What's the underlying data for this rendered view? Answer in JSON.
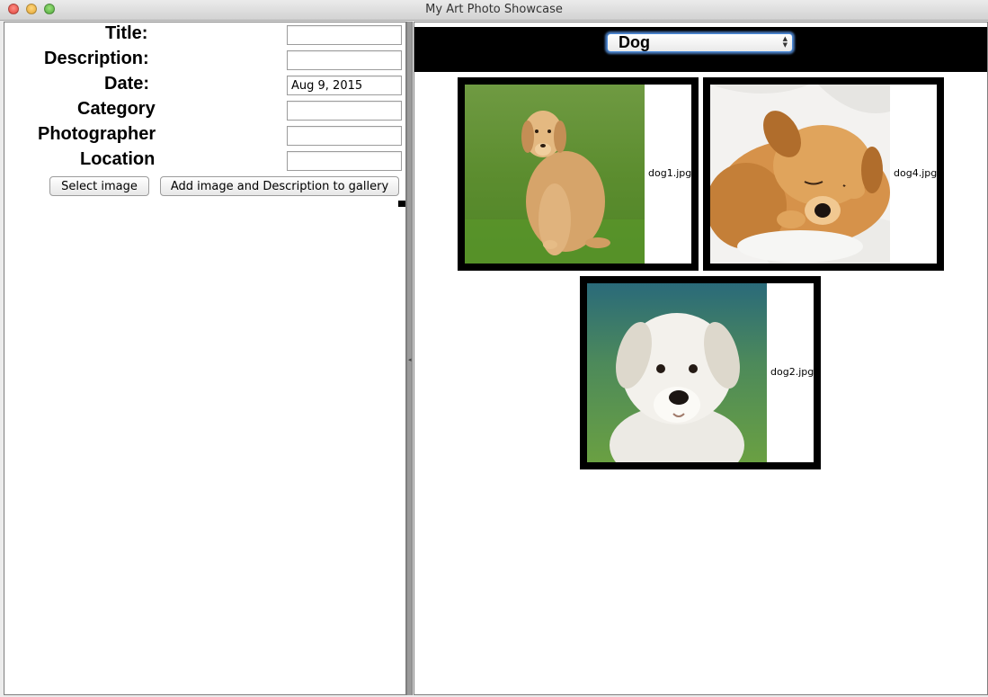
{
  "window": {
    "title": "My Art Photo Showcase"
  },
  "form": {
    "title_label": "Title:",
    "description_label": "Description:",
    "date_label": "Date:",
    "category_label": "Category",
    "photographer_label": "Photographer",
    "location_label": "Location",
    "title_value": "",
    "description_value": "",
    "date_value": "Aug 9, 2015",
    "category_value": "",
    "photographer_value": "",
    "location_value": "",
    "select_image_label": "Select image",
    "add_label": "Add image and Description to gallery"
  },
  "gallery": {
    "category": "Dog",
    "items": [
      {
        "filename": "dog1.jpg"
      },
      {
        "filename": "dog4.jpg"
      },
      {
        "filename": "dog2.jpg"
      }
    ]
  }
}
